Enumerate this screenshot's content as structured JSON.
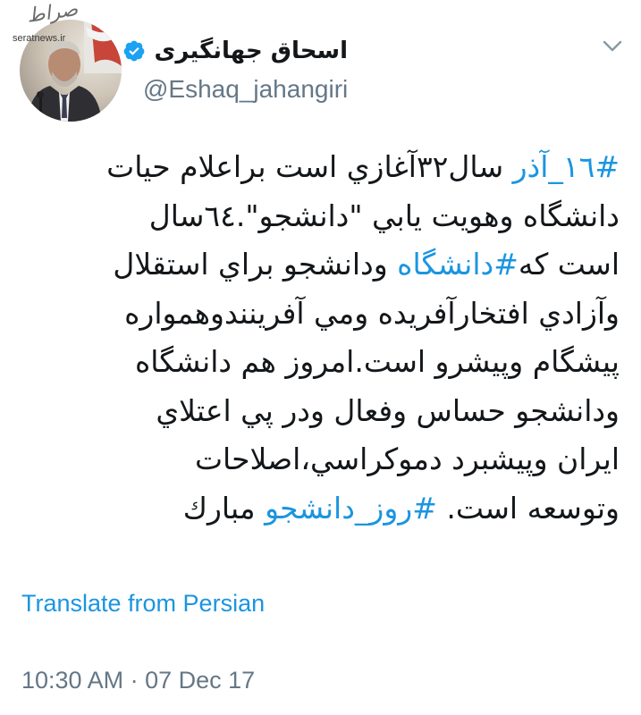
{
  "watermark": {
    "logo": "صراط",
    "site": "seratnews.ir"
  },
  "author": {
    "name": "اسحاق جهانگیری",
    "handle": "@Eshaq_jahangiri",
    "verified": true
  },
  "tweet": {
    "lines": [
      {
        "hashtag": "#١٦_آذر",
        "text": " سال٣٢آغازي است براعلام حيات"
      },
      {
        "text": "دانشگاه وهويت يابي \"دانشجو\".٦٤سال"
      },
      {
        "text_before": "است كه",
        "hashtag": "#دانشگاه",
        "text_after": " ودانشجو براي استقلال"
      },
      {
        "text": "وآزادي افتخارآفريده ومي آفرينندوهمواره"
      },
      {
        "text": "پيشگام وپيشرو است.امروز هم دانشگاه"
      },
      {
        "text": "ودانشجو حساس وفعال ودر پي اعتلاي"
      },
      {
        "text": "ايران وپيشبرد دموكراسي،اصلاحات"
      },
      {
        "text_before": "وتوسعه است. ",
        "hashtag": "#روز_دانشجو",
        "text_after": " مبارك"
      }
    ]
  },
  "translate_label": "Translate from Persian",
  "timestamp": {
    "time": "10:30 AM",
    "separator": " · ",
    "date": "07 Dec 17"
  },
  "colors": {
    "link": "#1b95e0",
    "text": "#14171a",
    "muted": "#657786",
    "verified": "#1da1f2"
  },
  "icons": {
    "menu": "chevron-down-icon",
    "verified": "verified-badge-icon"
  }
}
